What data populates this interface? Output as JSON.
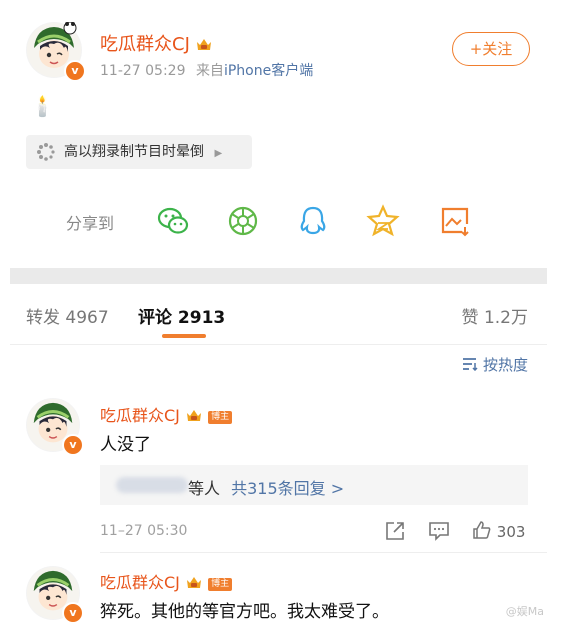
{
  "post": {
    "author_name": "吃瓜群众CJ",
    "time": "11-27 05:29",
    "source_prefix": "来自",
    "source": "iPhone客户端",
    "follow_label": "+关注",
    "emoji": "🕯️",
    "topic": "高以翔录制节目时晕倒",
    "share_label": "分享到",
    "share_icons": [
      "wechat-icon",
      "moments-icon",
      "qq-icon",
      "qzone-icon",
      "save-image-icon"
    ]
  },
  "tabs": {
    "repost_label": "转发",
    "repost_count": "4967",
    "comment_label": "评论",
    "comment_count": "2913",
    "like_label": "赞",
    "like_count": "1.2万",
    "sort_label": "按热度"
  },
  "comments": [
    {
      "author": "吃瓜群众CJ",
      "badge": "博主",
      "text": "人没了",
      "reply_suffix": "等人",
      "reply_link": "共315条回复 >",
      "time": "11–27 05:30",
      "likes": "303"
    },
    {
      "author": "吃瓜群众CJ",
      "badge": "博主",
      "text": "猝死。其他的等官方吧。我太难受了。"
    }
  ],
  "watermark": "@娱Ma",
  "colors": {
    "accent": "#f07e2e",
    "name": "#e8551b",
    "link": "#5175a6"
  }
}
